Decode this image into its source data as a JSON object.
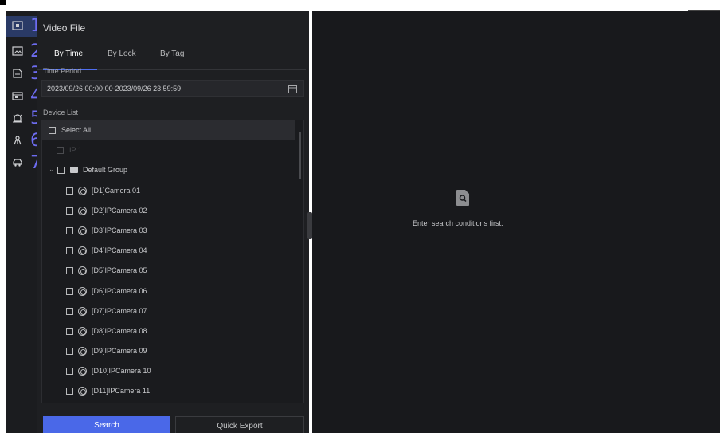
{
  "panel": {
    "title": "Video File",
    "tabs": [
      "By Time",
      "By Lock",
      "By Tag"
    ],
    "time_period_label": "Time Period",
    "time_period_value": "2023/09/26 00:00:00-2023/09/26 23:59:59",
    "device_list_label": "Device List",
    "select_all": "Select All",
    "faint_item": "IP 1",
    "group": "Default Group",
    "devices": [
      "[D1]Camera 01",
      "[D2]IPCamera 02",
      "[D3]IPCamera 03",
      "[D4]IPCamera 04",
      "[D5]IPCamera 05",
      "[D6]IPCamera 06",
      "[D7]IPCamera 07",
      "[D8]IPCamera 08",
      "[D9]IPCamera 09",
      "[D10]IPCamera 10",
      "[D11]IPCamera 11"
    ],
    "search_button": "Search",
    "export_button": "Quick Export"
  },
  "rail": {
    "numbers": [
      "1",
      "2",
      "3",
      "4",
      "5",
      "6",
      "7"
    ],
    "icons": [
      "video-file-icon",
      "picture-icon",
      "document-icon",
      "calendar-event-icon",
      "alarm-icon",
      "person-icon",
      "vehicle-icon"
    ]
  },
  "main": {
    "empty_message": "Enter search conditions first."
  },
  "colors": {
    "accent": "#4a68e8",
    "rail_number": "#6d6cf0",
    "panel_bg": "#1e1f22",
    "main_bg": "#18191c"
  }
}
